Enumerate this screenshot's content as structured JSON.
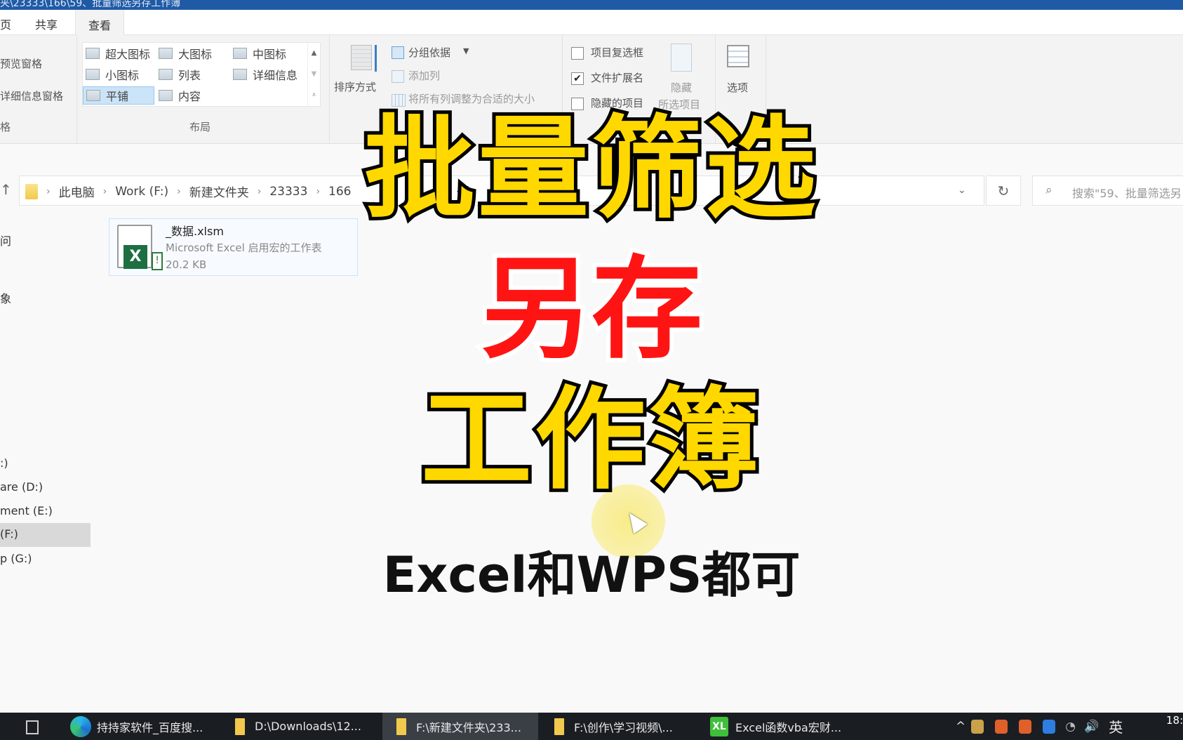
{
  "window": {
    "title": "夹\\23333\\166\\59、批量筛选另存工作簿"
  },
  "ribbon": {
    "tabs": [
      {
        "label": "页"
      },
      {
        "label": "共享"
      },
      {
        "label": "查看",
        "active": true
      }
    ],
    "panes": {
      "preview_pane": "预览窗格",
      "details_pane": "详细信息窗格",
      "group_label": "格"
    },
    "layout": {
      "items": [
        {
          "label": "超大图标"
        },
        {
          "label": "大图标"
        },
        {
          "label": "中图标"
        },
        {
          "label": "小图标"
        },
        {
          "label": "列表"
        },
        {
          "label": "详细信息"
        },
        {
          "label": "平铺",
          "selected": true
        },
        {
          "label": "内容"
        }
      ],
      "group_label": "布局"
    },
    "current_view": {
      "sort_by": "排序方式",
      "group_by": "分组依据",
      "add_column": "添加列",
      "size_columns": "将所有列调整为合适的大小"
    },
    "show_hide": {
      "item_checkboxes": {
        "label": "项目复选框",
        "checked": false
      },
      "file_extensions": {
        "label": "文件扩展名",
        "checked": true
      },
      "hidden_items": {
        "label": "隐藏的项目",
        "checked": false
      },
      "hide_selected_line1": "隐藏",
      "hide_selected_line2": "所选项目"
    },
    "options": "选项"
  },
  "address": {
    "crumbs": [
      "此电脑",
      "Work (F:)",
      "新建文件夹",
      "23333",
      "166"
    ],
    "search_placeholder": "搜索\"59、批量筛选另"
  },
  "nav_pane": {
    "items": [
      {
        "label": "问"
      },
      {
        "label": "象"
      },
      {
        "label": ":)"
      },
      {
        "label": "are (D:)"
      },
      {
        "label": "ment (E:)"
      },
      {
        "label": " (F:)",
        "selected": true
      },
      {
        "label": "p (G:)"
      }
    ]
  },
  "files": [
    {
      "name": "_数据.xlsm",
      "type": "Microsoft Excel 启用宏的工作表",
      "size": "20.2 KB"
    }
  ],
  "overlay": {
    "line1": "批量筛选",
    "line2": "另存",
    "line3": "工作簿",
    "subtitle": "Excel和WPS都可",
    "colors": {
      "yellow": "#ffd800",
      "red": "#ff1414",
      "outline": "#000000"
    }
  },
  "taskbar": {
    "items": [
      {
        "label": "持持家软件_百度搜...",
        "icon": "edge-icon"
      },
      {
        "label": "D:\\Downloads\\12...",
        "icon": "folder-icon"
      },
      {
        "label": "F:\\新建文件夹\\233...",
        "icon": "folder-icon",
        "active": true
      },
      {
        "label": "F:\\创作\\学习视频\\...",
        "icon": "folder-icon"
      },
      {
        "label": "Excel函数vba宏财...",
        "icon": "excel-icon"
      }
    ],
    "tray": {
      "chevron": "^",
      "ime": "英",
      "volume": "🔊",
      "clock": "18:"
    }
  }
}
